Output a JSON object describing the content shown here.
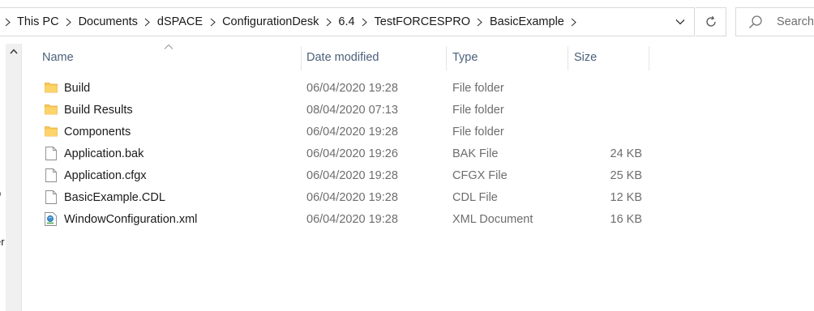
{
  "address_bar": {
    "breadcrumbs": [
      "This PC",
      "Documents",
      "dSPACE",
      "ConfigurationDesk",
      "6.4",
      "TestFORCESPRO",
      "BasicExample"
    ]
  },
  "search": {
    "placeholder": "Search"
  },
  "nav_pane": {
    "partial_glyphs": [
      "b",
      "er"
    ]
  },
  "columns": {
    "name": "Name",
    "date": "Date modified",
    "type": "Type",
    "size": "Size"
  },
  "files": [
    {
      "name": "Build",
      "date": "06/04/2020 19:28",
      "type": "File folder",
      "size": "",
      "icon": "folder-icon"
    },
    {
      "name": "Build Results",
      "date": "08/04/2020 07:13",
      "type": "File folder",
      "size": "",
      "icon": "folder-icon"
    },
    {
      "name": "Components",
      "date": "06/04/2020 19:28",
      "type": "File folder",
      "size": "",
      "icon": "folder-icon"
    },
    {
      "name": "Application.bak",
      "date": "06/04/2020 19:26",
      "type": "BAK File",
      "size": "24 KB",
      "icon": "file-icon"
    },
    {
      "name": "Application.cfgx",
      "date": "06/04/2020 19:28",
      "type": "CFGX File",
      "size": "25 KB",
      "icon": "file-icon"
    },
    {
      "name": "BasicExample.CDL",
      "date": "06/04/2020 19:28",
      "type": "CDL File",
      "size": "12 KB",
      "icon": "file-icon"
    },
    {
      "name": "WindowConfiguration.xml",
      "date": "06/04/2020 19:28",
      "type": "XML Document",
      "size": "16 KB",
      "icon": "xml-file-icon"
    }
  ],
  "colors": {
    "header_text": "#4c607a",
    "detail_text": "#6d6d6d",
    "folder_yellow": "#f8c94c",
    "border": "#d9d9d9"
  }
}
